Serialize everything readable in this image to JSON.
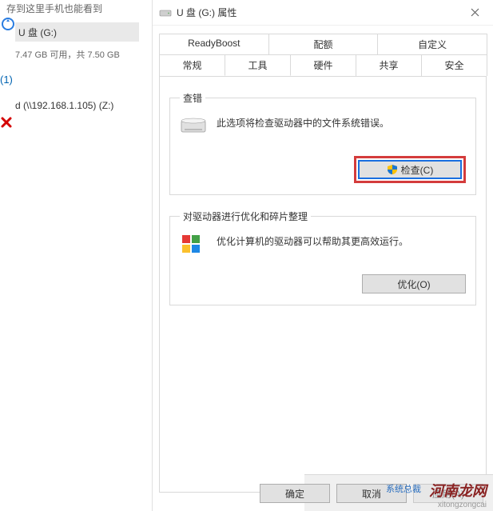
{
  "bg": {
    "status_text": "存到这里手机也能看到",
    "drive_label": "U 盘 (G:)",
    "storage_text": "7.47 GB 可用，共 7.50 GB",
    "heading_one": "(1)",
    "net_drive": "d (\\\\192.168.1.105) (Z:)"
  },
  "dialog": {
    "title": "U 盘 (G:) 属性",
    "tabs_top": [
      "ReadyBoost",
      "配额",
      "自定义"
    ],
    "tabs_bottom": [
      "常规",
      "工具",
      "硬件",
      "共享",
      "安全"
    ],
    "active_tab": "工具",
    "errorcheck": {
      "legend": "查错",
      "desc": "此选项将检查驱动器中的文件系统错误。",
      "button": "检查(C)"
    },
    "optimize": {
      "legend": "对驱动器进行优化和碎片整理",
      "desc": "优化计算机的驱动器可以帮助其更高效运行。",
      "button": "优化(O)"
    },
    "footer": {
      "ok": "确定",
      "cancel": "取消",
      "apply": "应用(A)"
    }
  },
  "watermark": {
    "main": "河南龙网",
    "blue": "系统总裁",
    "sub": "xitongzongcai"
  }
}
